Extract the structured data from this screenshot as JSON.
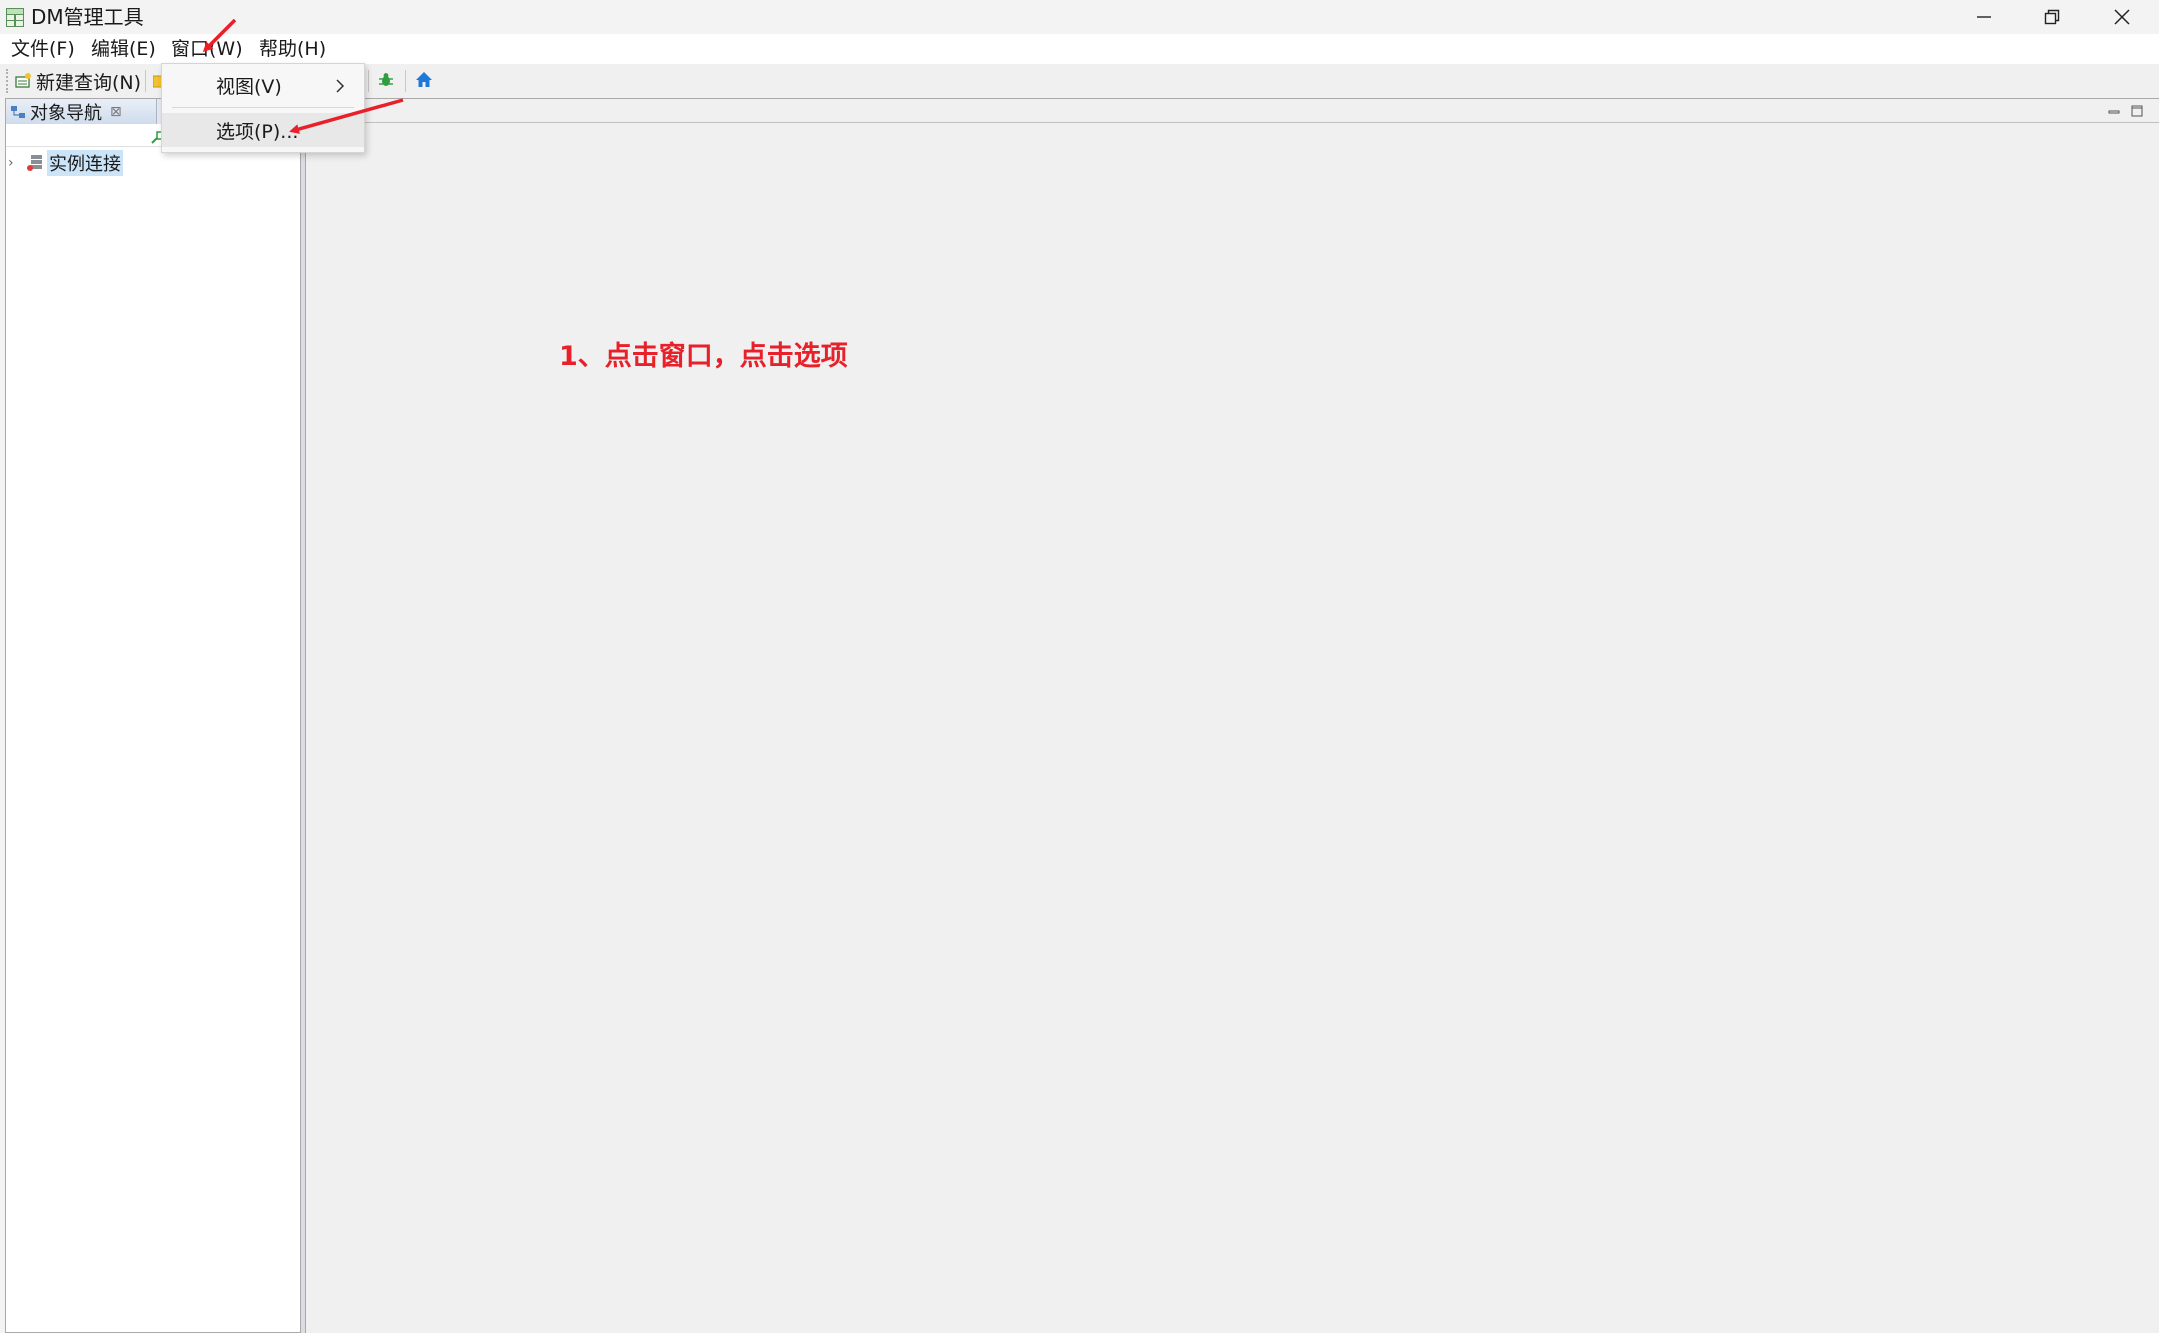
{
  "window": {
    "title": "DM管理工具",
    "controls": [
      "minimize-icon",
      "restore-icon",
      "close-icon"
    ]
  },
  "menubar": {
    "items": [
      "文件(F)",
      "编辑(E)",
      "窗口(W)",
      "帮助(H)"
    ]
  },
  "toolbar": {
    "new_query_label": "新建查询(N)",
    "icons": [
      "new-query-icon",
      "folder-icon",
      "debug-bug-icon",
      "home-icon"
    ]
  },
  "dropdown": {
    "items": [
      {
        "label": "视图(V)",
        "has_submenu": true
      },
      {
        "label": "选项(P)...",
        "has_submenu": false
      }
    ]
  },
  "navigator": {
    "tab_label": "对象导航",
    "tree": [
      {
        "label": "实例连接",
        "selected": true,
        "expanded": false
      }
    ]
  },
  "annotation": {
    "text": "1、点击窗口，点击选项",
    "color": "#e8202a"
  },
  "colors": {
    "accent_red": "#e8202a",
    "selection": "#cce4f7",
    "home_icon": "#1e78d7",
    "bug_icon": "#2e9e3e"
  }
}
